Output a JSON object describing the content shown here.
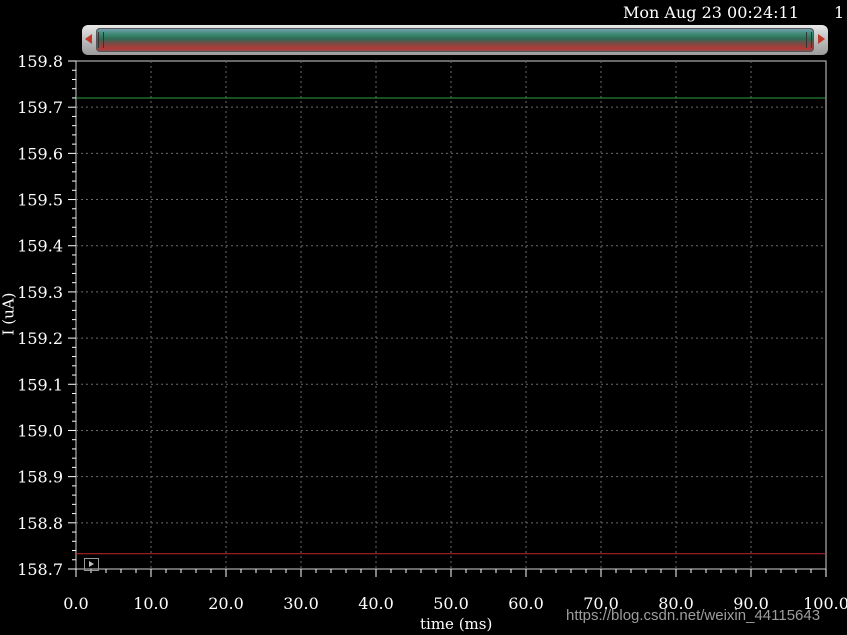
{
  "header": {
    "timestamp": "Mon Aug 23 00:24:11",
    "index": "1"
  },
  "watermark": "https://blog.csdn.net/weixin_44115643",
  "chart_data": {
    "type": "line",
    "xlabel": "time (ms)",
    "ylabel": "I (uA)",
    "xlim": [
      0,
      100
    ],
    "ylim": [
      158.7,
      159.8
    ],
    "x_ticks": [
      "0.0",
      "10.0",
      "20.0",
      "30.0",
      "40.0",
      "50.0",
      "60.0",
      "70.0",
      "80.0",
      "90.0",
      "100.0"
    ],
    "y_ticks": [
      "159.8",
      "159.7",
      "159.6",
      "159.5",
      "159.4",
      "159.3",
      "159.2",
      "159.1",
      "159.0",
      "158.9",
      "158.8",
      "158.7"
    ],
    "grid": true,
    "series": [
      {
        "x": [
          0,
          100
        ],
        "y": [
          159.72,
          159.72
        ],
        "color": "#2e9e3c"
      },
      {
        "x": [
          0,
          100
        ],
        "y": [
          158.733,
          158.733
        ],
        "color": "#c0282a"
      }
    ]
  }
}
